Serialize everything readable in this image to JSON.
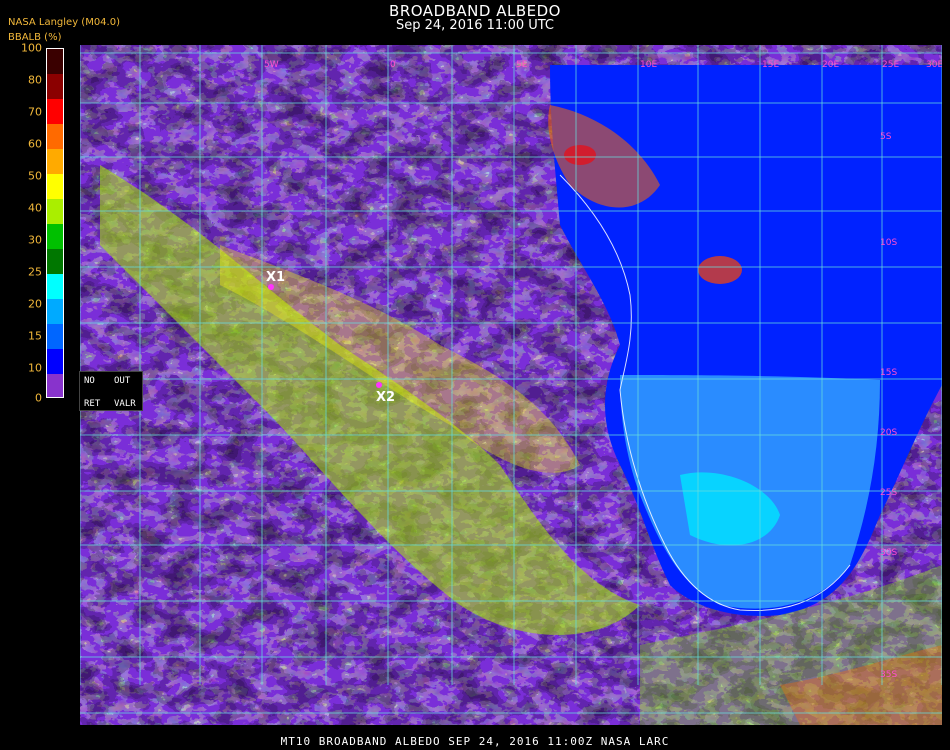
{
  "header": {
    "title": "BROADBAND ALBEDO",
    "subtitle": "Sep 24, 2016 11:00 UTC",
    "product": "NASA Langley (M04.0)",
    "unit": "BBALB (%)"
  },
  "colorbar": {
    "ticks": [
      "100",
      "80",
      "70",
      "60",
      "50",
      "40",
      "30",
      "25",
      "20",
      "15",
      "10",
      "0"
    ],
    "colors": [
      "#3a0000",
      "#8b0000",
      "#ff0000",
      "#ff6a00",
      "#ffaa00",
      "#ffff00",
      "#aaee00",
      "#00c000",
      "#007700",
      "#00ffff",
      "#00aaff",
      "#0066ff",
      "#0000ff",
      "#8833cc"
    ]
  },
  "legend_box": {
    "no": "NO",
    "out": "OUT",
    "ret": "RET",
    "valr": "VALR"
  },
  "markers": [
    {
      "label": "X1"
    },
    {
      "label": "X2"
    }
  ],
  "lon_labels": [
    "5W",
    "0",
    "5E",
    "10E",
    "15E",
    "20E",
    "25E",
    "30E"
  ],
  "lat_labels": [
    "5S",
    "10S",
    "15S",
    "20S",
    "25S",
    "30S",
    "35S"
  ],
  "colors": {
    "ocean": "#7a2ed8",
    "grid": "#66dddd",
    "marker": "#ff33ff",
    "text_orange": "#f2b83a"
  },
  "footer": "MT10  BROADBAND ALBEDO   SEP 24, 2016 11:00Z   NASA LARC"
}
